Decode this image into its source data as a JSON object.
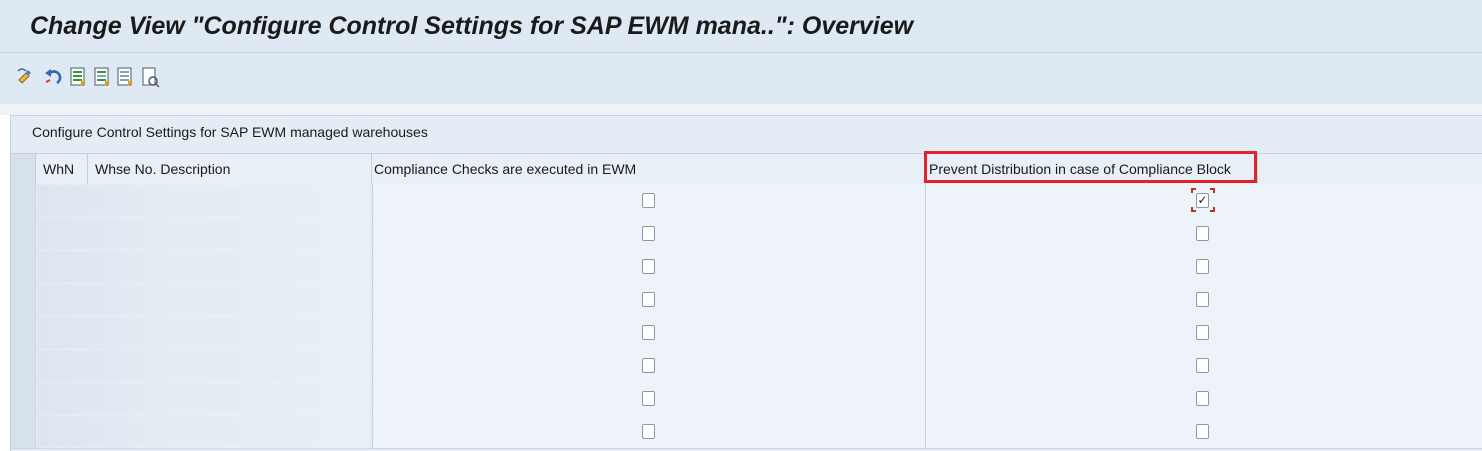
{
  "title": "Change View \"Configure Control Settings for SAP EWM mana..\": Overview",
  "toolbar": {
    "buttons": [
      {
        "icon": "display-change-icon"
      },
      {
        "icon": "undo-icon"
      },
      {
        "icon": "select-all-icon"
      },
      {
        "icon": "select-block-icon"
      },
      {
        "icon": "deselect-all-icon"
      },
      {
        "icon": "print-icon"
      }
    ]
  },
  "table": {
    "caption": "Configure Control Settings for SAP EWM managed warehouses",
    "columns": {
      "whn": "WhN",
      "description": "Whse No. Description",
      "compliance_checks": "Compliance Checks are executed in EWM",
      "prevent_distribution": "Prevent Distribution in case of Compliance Block"
    },
    "rows": [
      {
        "compliance_checks": false,
        "prevent_distribution": true
      },
      {
        "compliance_checks": false,
        "prevent_distribution": false
      },
      {
        "compliance_checks": false,
        "prevent_distribution": false
      },
      {
        "compliance_checks": false,
        "prevent_distribution": false
      },
      {
        "compliance_checks": false,
        "prevent_distribution": false
      },
      {
        "compliance_checks": false,
        "prevent_distribution": false
      },
      {
        "compliance_checks": false,
        "prevent_distribution": false
      },
      {
        "compliance_checks": false,
        "prevent_distribution": false
      }
    ],
    "check_glyph": "✓"
  },
  "colors": {
    "highlight": "#e0252a",
    "title_bar": "#dfe9f3"
  }
}
